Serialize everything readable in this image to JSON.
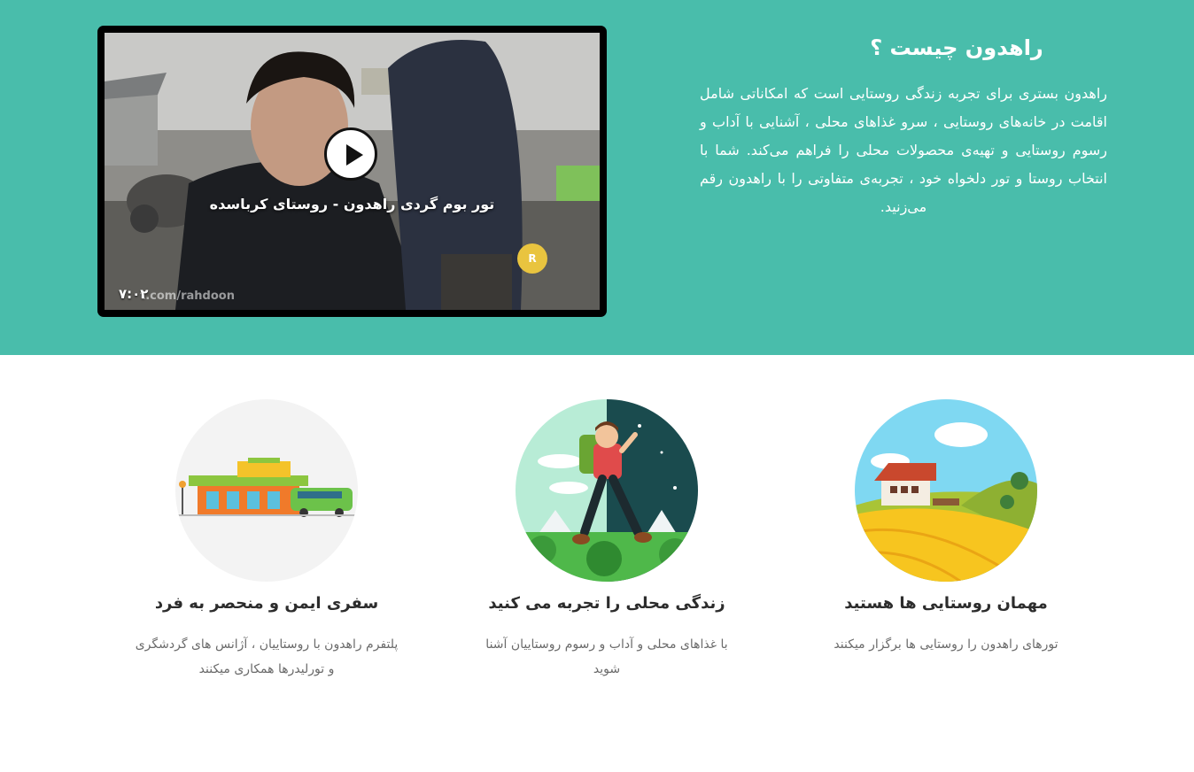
{
  "hero": {
    "background": "#49bdab",
    "video": {
      "title": "تور بوم گردی راهدون - روستای کرباسده",
      "duration": "۷:۰۲",
      "watermark": "t.com/rahdoon",
      "badge_text": "راهدون"
    },
    "about": {
      "heading": "راهدون چیست ؟",
      "body": "راهدون بستری برای تجربه زندگی روستایی است که امکاناتی شامل اقامت در خانه‌های روستایی ، سرو غذاهای محلی ، آشنایی با آداب و رسوم روستایی و تهیه‌ی محصولات محلی را فراهم می‌کند. شما با انتخاب روستا و تور دلخواه خود ، تجربه‌ی متفاوتی را با راهدون رقم می‌زنید."
    }
  },
  "features": [
    {
      "title": "مهمان روستایی ها هستید",
      "description": "تورهای راهدون را روستایی ها برگزار میکنند",
      "icon": "village-house-icon"
    },
    {
      "title": "زندگی محلی را تجربه می کنید",
      "description": "با غذاهای محلی و آداب و رسوم روستاییان آشنا شوید",
      "icon": "hiker-icon"
    },
    {
      "title": "سفری ایمن و منحصر به فرد",
      "description": "پلتفرم راهدون با روستاییان ، آژانس های گردشگری و تورلیدرها همکاری میکنند",
      "icon": "bus-station-icon"
    }
  ]
}
